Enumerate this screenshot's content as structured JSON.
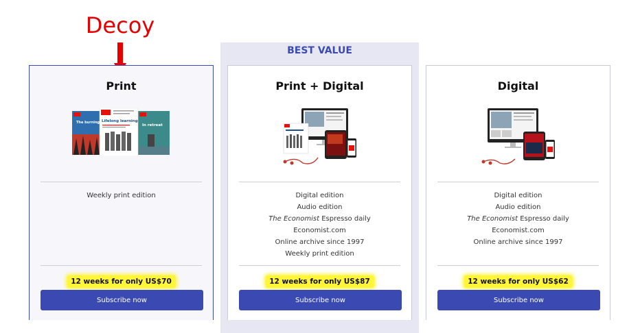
{
  "annotation": {
    "text": "Decoy",
    "color": "#e60000"
  },
  "best_value_label": "BEST VALUE",
  "accent_color": "#3b4ab2",
  "highlight_color": "#fff53a",
  "plans": [
    {
      "title": "Print",
      "image": "magazine-covers",
      "cover_texts": [
        "The burning question",
        "Lifelong learning",
        "In retreat"
      ],
      "features": [
        {
          "text": "Weekly print edition"
        }
      ],
      "price": "12 weeks for only US$70",
      "button": "Subscribe now"
    },
    {
      "title": "Print + Digital",
      "image": "devices-and-magazine",
      "features": [
        {
          "text": "Digital edition"
        },
        {
          "text": "Audio edition"
        },
        {
          "italic": "The Economist",
          "text": " Espresso daily"
        },
        {
          "text": "Economist.com"
        },
        {
          "text": "Online archive since 1997"
        },
        {
          "text": "Weekly print edition"
        }
      ],
      "price": "12 weeks for only US$87",
      "button": "Subscribe now"
    },
    {
      "title": "Digital",
      "image": "devices",
      "features": [
        {
          "text": "Digital edition"
        },
        {
          "text": "Audio edition"
        },
        {
          "italic": "The Economist",
          "text": " Espresso daily"
        },
        {
          "text": "Economist.com"
        },
        {
          "text": "Online archive since 1997"
        }
      ],
      "price": "12 weeks for only US$62",
      "button": "Subscribe now"
    }
  ]
}
